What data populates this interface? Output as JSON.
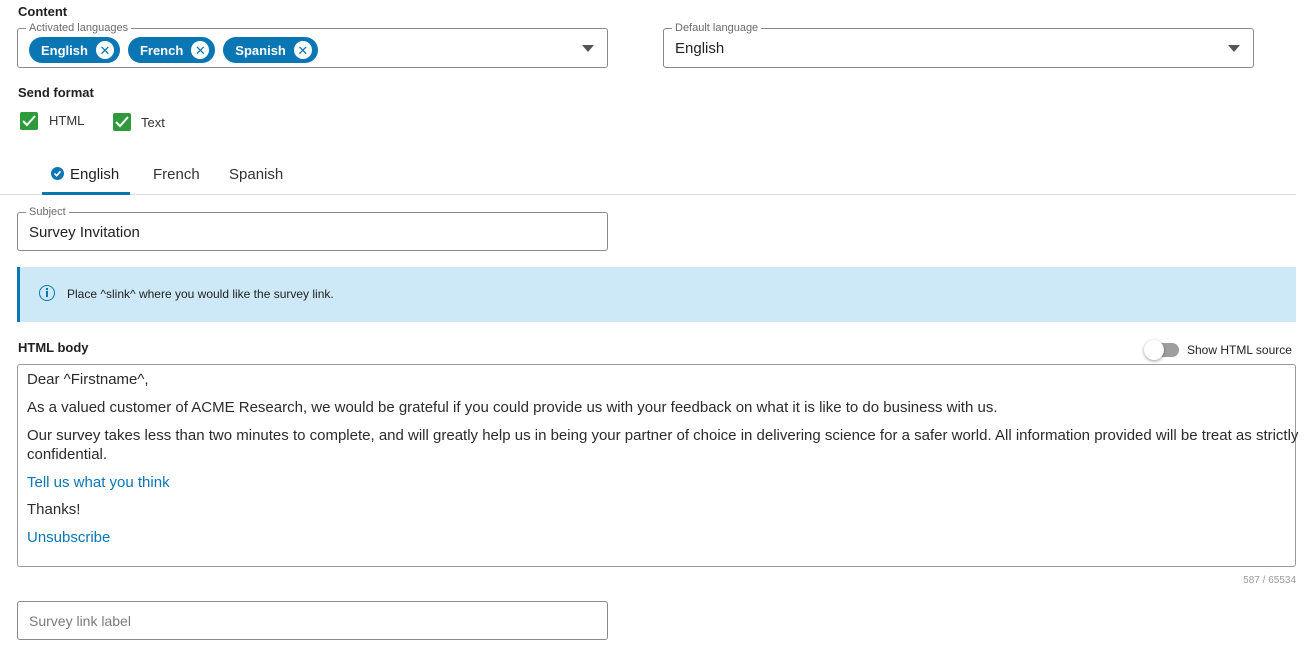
{
  "content": {
    "section_label": "Content",
    "activated_languages": {
      "legend": "Activated languages",
      "chips": [
        "English",
        "French",
        "Spanish"
      ]
    },
    "default_language": {
      "legend": "Default language",
      "value": "English"
    }
  },
  "send_format": {
    "label": "Send format",
    "options": [
      {
        "label": "HTML",
        "checked": true
      },
      {
        "label": "Text",
        "checked": true
      }
    ]
  },
  "tabs": [
    {
      "label": "English",
      "active": true
    },
    {
      "label": "French",
      "active": false
    },
    {
      "label": "Spanish",
      "active": false
    }
  ],
  "subject": {
    "legend": "Subject",
    "value": "Survey Invitation"
  },
  "info": {
    "text": "Place ^slink^ where you would like the survey link."
  },
  "html_body": {
    "label": "HTML body",
    "toggle_label": "Show HTML source",
    "lines": [
      "Dear ^Firstname^,",
      "As a valued customer of ACME Research, we would be grateful if you could provide us with your feedback on what it is like to do business with us.",
      "Our survey takes less than two minutes to complete, and will greatly help us in being your partner of choice in delivering science for a safer world. All information provided will be treat as strictly",
      "confidential.",
      "Tell us what you think",
      "Thanks!",
      "Unsubscribe"
    ],
    "char_count": "587 / 65534"
  },
  "survey_link": {
    "placeholder": "Survey link label"
  },
  "colors": {
    "accent": "#0a76b3",
    "check": "#2e9a3b",
    "banner": "#cde9f8"
  }
}
